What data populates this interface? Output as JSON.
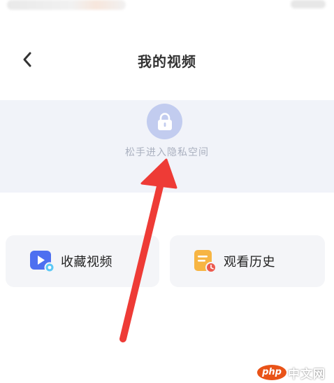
{
  "header": {
    "title": "我的视频",
    "back_icon": "chevron-left-icon"
  },
  "private_space": {
    "lock_icon": "lock-icon",
    "hint": "松手进入隐私空间"
  },
  "actions": {
    "favorites": {
      "label": "收藏视频",
      "icon": "video-play-icon"
    },
    "history": {
      "label": "观看历史",
      "icon": "history-note-icon"
    }
  },
  "watermark": {
    "badge": "php",
    "text": "中文网"
  },
  "colors": {
    "arrow": "#ee3b36",
    "lock_circle": "#c2ccef",
    "hidden_zone_bg": "#f1f3f9",
    "card_bg": "#f4f5f8"
  }
}
